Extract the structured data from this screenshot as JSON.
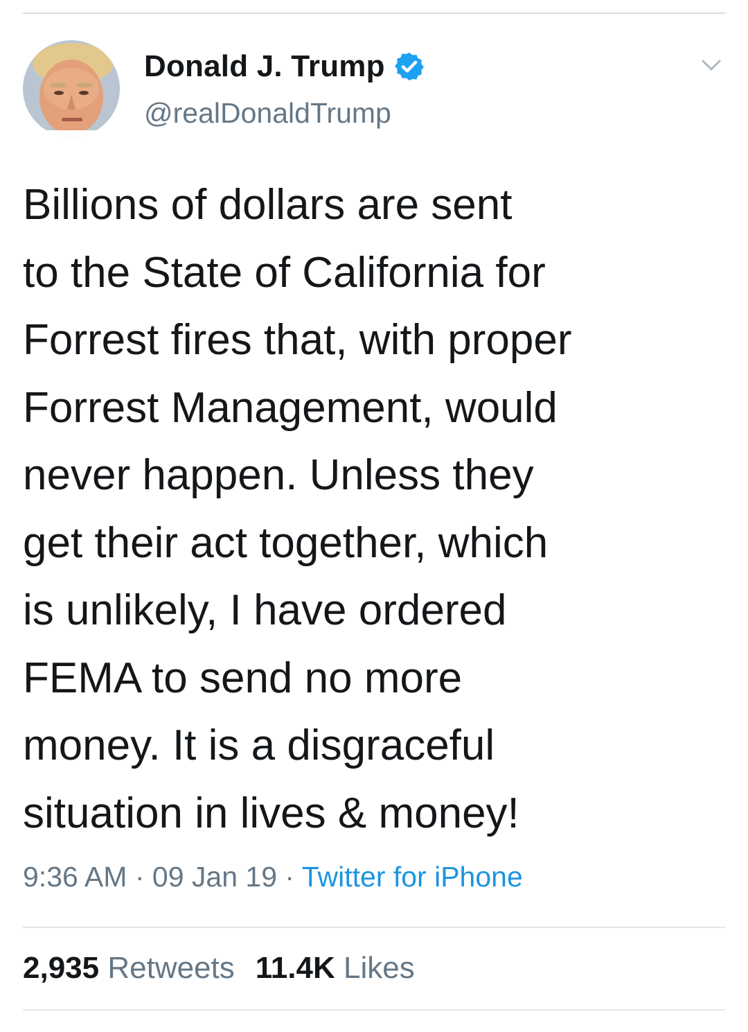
{
  "user": {
    "display_name": "Donald J. Trump",
    "handle": "@realDonaldTrump",
    "verified": true,
    "avatar_icon": "profile-photo",
    "menu_icon": "chevron-down-icon"
  },
  "tweet": {
    "lines": [
      "Billions of dollars are sent",
      "to the State of California for",
      "Forrest fires that, with proper",
      "Forrest Management, would",
      "never happen. Unless they",
      "get their act together, which",
      "is unlikely, I have ordered",
      "FEMA to send no more",
      "money. It is a disgraceful",
      "situation in lives & money!"
    ]
  },
  "meta": {
    "time": "9:36 AM",
    "separator": "·",
    "date": "09 Jan 19",
    "source": "Twitter for iPhone"
  },
  "stats": {
    "retweets_count": "2,935",
    "retweets_label": "Retweets",
    "likes_count": "11.4K",
    "likes_label": "Likes"
  },
  "colors": {
    "text": "#14171a",
    "secondary": "#657786",
    "link": "#1b95e0",
    "verified": "#1da1f2",
    "divider": "#e1e8ed"
  }
}
